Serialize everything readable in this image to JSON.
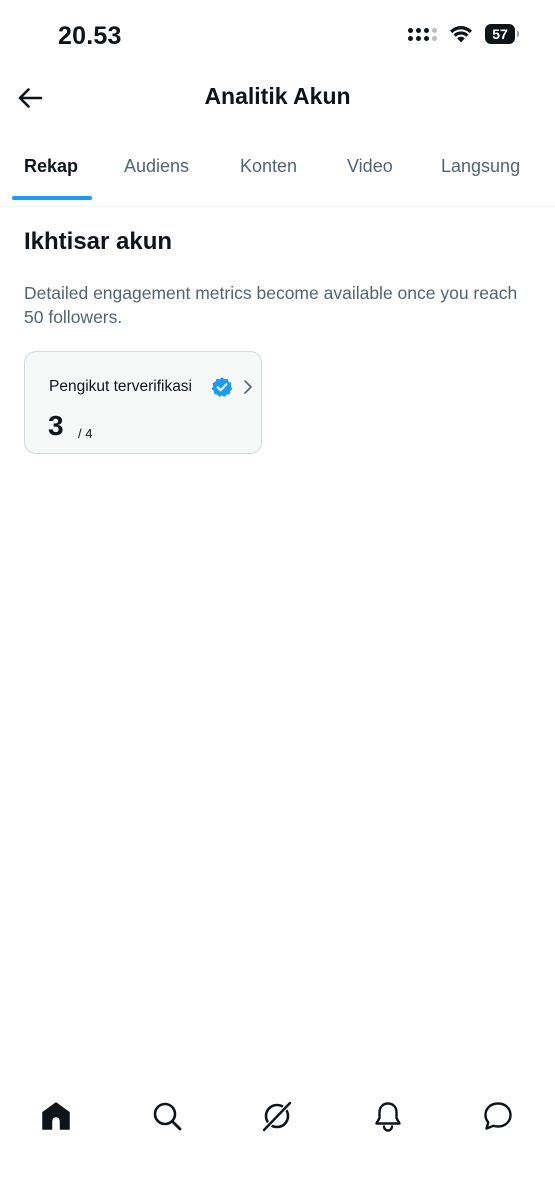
{
  "status_bar": {
    "time": "20.53",
    "battery_level": "57",
    "icons": [
      "signal-icon",
      "wifi-icon",
      "battery-icon"
    ]
  },
  "header": {
    "title": "Analitik Akun",
    "back_icon": "arrow-left-icon"
  },
  "tabs": [
    {
      "label": "Rekap",
      "active": true
    },
    {
      "label": "Audiens",
      "active": false
    },
    {
      "label": "Konten",
      "active": false
    },
    {
      "label": "Video",
      "active": false
    },
    {
      "label": "Langsung",
      "active": false
    }
  ],
  "overview": {
    "title": "Ikhtisar akun",
    "description": "Detailed engagement metrics become available once you reach 50 followers.",
    "card": {
      "label": "Pengikut terverifikasi",
      "value": "3",
      "total": "/ 4",
      "icons": [
        "verified-badge-icon",
        "chevron-right-icon"
      ]
    }
  },
  "bottom_nav": {
    "items": [
      "home-icon",
      "search-icon",
      "grok-icon",
      "notifications-icon",
      "messages-icon"
    ]
  },
  "colors": {
    "accent": "#1d9bf0",
    "text_primary": "#0f1419",
    "text_secondary": "#536471",
    "card_background": "#f7f9f9",
    "card_border": "#cfd9de"
  }
}
